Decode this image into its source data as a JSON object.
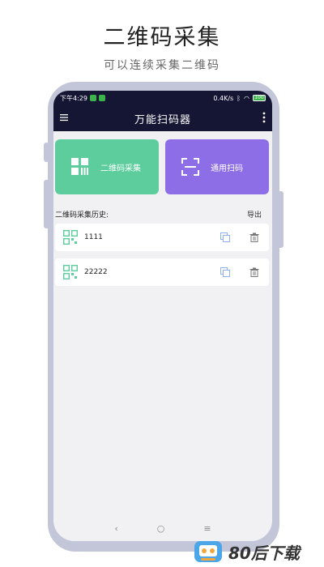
{
  "header": {
    "title": "二维码采集",
    "subtitle": "可以连续采集二维码"
  },
  "status_bar": {
    "time": "下午4:29",
    "speed": "0.4K/s",
    "battery": "100"
  },
  "app_bar": {
    "title": "万能扫码器"
  },
  "cards": {
    "qr_collect": "二维码采集",
    "general_scan": "通用扫码"
  },
  "history": {
    "title": "二维码采集历史:",
    "export_label": "导出",
    "items": [
      "1111",
      "22222"
    ]
  },
  "navbar": {
    "back": "‹",
    "home": "○",
    "recent": "≡"
  },
  "watermark": {
    "text": "80后下载"
  },
  "colors": {
    "qr_card": "#5dcd9d",
    "scan_card": "#8d6ee6",
    "app_bar": "#151633",
    "phone_frame": "#c3c6d9"
  }
}
